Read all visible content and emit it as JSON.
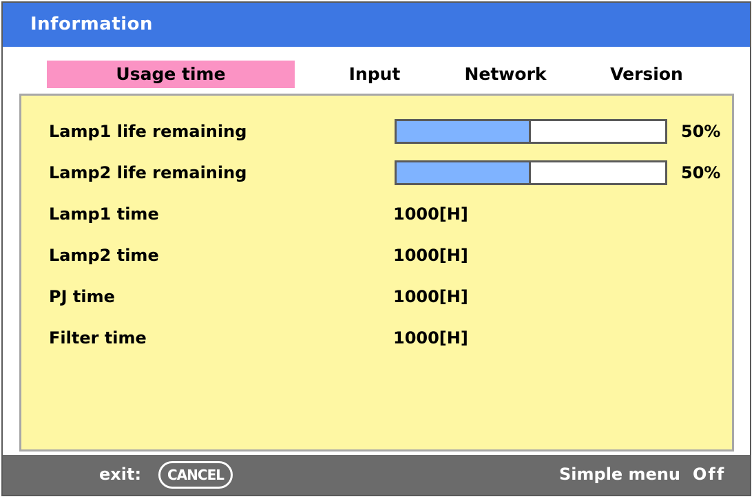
{
  "window": {
    "title": "Information"
  },
  "tabs": [
    {
      "label": "Usage time",
      "active": true
    },
    {
      "label": "Input",
      "active": false
    },
    {
      "label": "Network",
      "active": false
    },
    {
      "label": "Version",
      "active": false
    }
  ],
  "usage": {
    "lamp1_life": {
      "label": "Lamp1 life remaining",
      "value": "50%",
      "fraction": 0.5
    },
    "lamp2_life": {
      "label": "Lamp2 life remaining",
      "value": "50%",
      "fraction": 0.5
    },
    "lamp1_time": {
      "label": "Lamp1 time",
      "value": "1000[H]"
    },
    "lamp2_time": {
      "label": "Lamp2 time",
      "value": "1000[H]"
    },
    "pj_time": {
      "label": "PJ time",
      "value": "1000[H]"
    },
    "filter_time": {
      "label": "Filter time",
      "value": "1000[H]"
    }
  },
  "footer": {
    "exit_label": "exit:",
    "cancel_label": "CANCEL",
    "simple_menu_label": "Simple menu",
    "simple_menu_value": "Off"
  },
  "colors": {
    "title_bar": "#3d77e3",
    "active_tab": "#fb93c4",
    "panel_bg": "#fef7a3",
    "bar_fill": "#7fb3ff",
    "status_bar": "#6b6b6b"
  }
}
